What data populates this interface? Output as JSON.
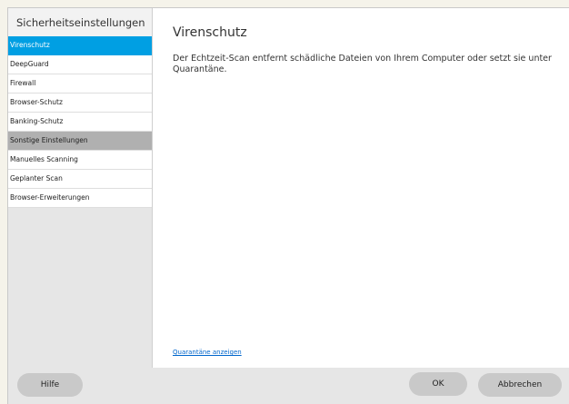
{
  "sidebar": {
    "title": "Sicherheitseinstellungen",
    "items": [
      {
        "label": "Virenschutz",
        "state": "active"
      },
      {
        "label": "DeepGuard",
        "state": "normal"
      },
      {
        "label": "Firewall",
        "state": "normal"
      },
      {
        "label": "Browser-Schutz",
        "state": "normal"
      },
      {
        "label": "Banking-Schutz",
        "state": "normal"
      },
      {
        "label": "Sonstige Einstellungen",
        "state": "hover"
      },
      {
        "label": "Manuelles Scanning",
        "state": "normal"
      },
      {
        "label": "Geplanter Scan",
        "state": "normal"
      },
      {
        "label": "Browser-Erweiterungen",
        "state": "normal"
      }
    ]
  },
  "main": {
    "title": "Virenschutz",
    "description": "Der Echtzeit-Scan entfernt schädliche Dateien von Ihrem Computer oder setzt sie unter Quarantäne.",
    "link_label": "Quarantäne anzeigen"
  },
  "footer": {
    "help_label": "Hilfe",
    "ok_label": "OK",
    "cancel_label": "Abbrechen"
  },
  "colors": {
    "accent": "#009fe3",
    "hover": "#b0b0b0",
    "link": "#0066cc"
  }
}
